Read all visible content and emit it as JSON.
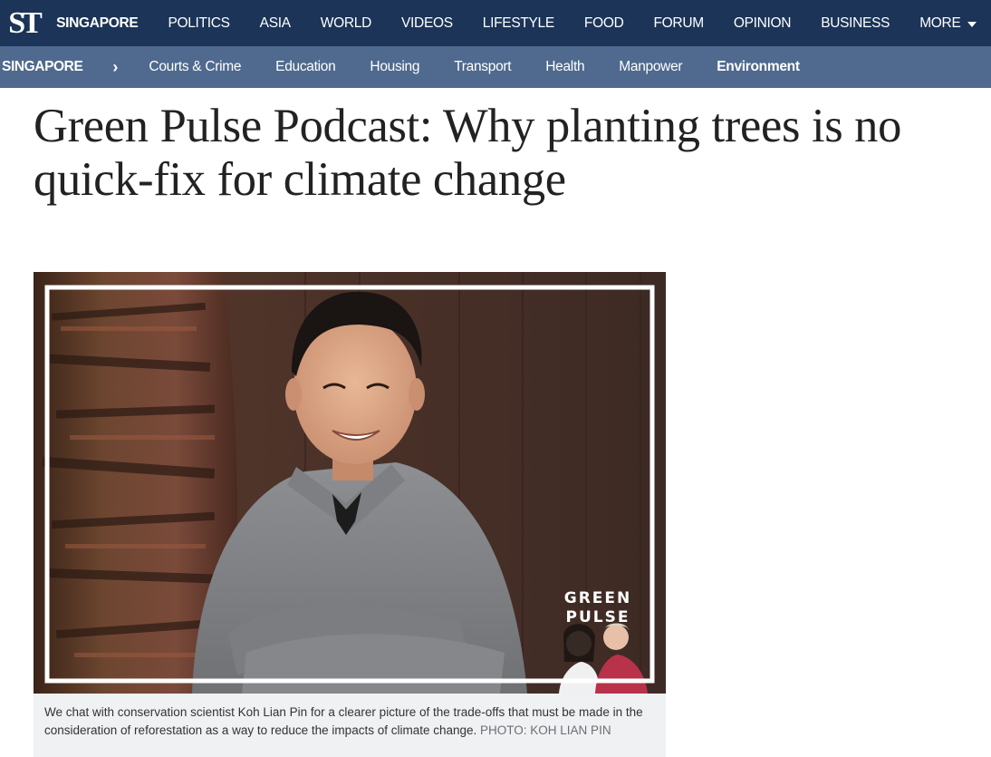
{
  "logo": "ST",
  "topnav": {
    "items": [
      {
        "label": "SINGAPORE",
        "active": true
      },
      {
        "label": "POLITICS"
      },
      {
        "label": "ASIA"
      },
      {
        "label": "WORLD"
      },
      {
        "label": "VIDEOS"
      },
      {
        "label": "LIFESTYLE"
      },
      {
        "label": "FOOD"
      },
      {
        "label": "FORUM"
      },
      {
        "label": "OPINION"
      },
      {
        "label": "BUSINESS"
      },
      {
        "label": "MORE"
      }
    ]
  },
  "subnav": {
    "section": "SINGAPORE",
    "separator": "›",
    "items": [
      {
        "label": "Courts & Crime"
      },
      {
        "label": "Education"
      },
      {
        "label": "Housing"
      },
      {
        "label": "Transport"
      },
      {
        "label": "Health"
      },
      {
        "label": "Manpower"
      },
      {
        "label": "Environment",
        "active": true
      }
    ]
  },
  "article": {
    "headline": "Green Pulse Podcast: Why planting trees is no quick-fix for climate change",
    "photo": {
      "badge_line1": "GREEN",
      "badge_line2": "PULSE"
    },
    "caption": "We chat with conservation scientist Koh Lian Pin for a clearer picture of the trade-offs that must be made in the consideration of reforestation as a way to reduce the impacts of climate change.",
    "credit": "PHOTO: KOH LIAN PIN"
  },
  "colors": {
    "topnav_bg": "#1b3457",
    "subnav_bg": "#4f6a8e",
    "headline_text": "#222222",
    "caption_bg": "#eff1f3"
  }
}
